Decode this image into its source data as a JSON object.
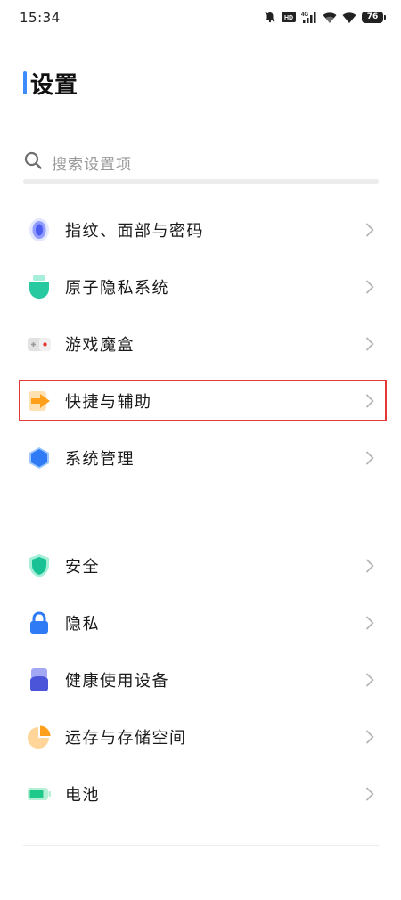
{
  "status_bar": {
    "time": "15:34",
    "battery": "76",
    "icons": [
      "mute-icon",
      "hd-icon",
      "signal-4g-icon",
      "wifi-icon",
      "wifi-icon",
      "battery-icon"
    ]
  },
  "header": {
    "title": "设置"
  },
  "search": {
    "placeholder": "搜索设置项"
  },
  "groups": [
    {
      "items": [
        {
          "label": "指纹、面部与密码",
          "icon": "fingerprint-icon"
        },
        {
          "label": "原子隐私系统",
          "icon": "privacy-system-icon"
        },
        {
          "label": "游戏魔盒",
          "icon": "game-box-icon"
        },
        {
          "label": "快捷与辅助",
          "icon": "shortcut-arrow-icon",
          "highlighted": true
        },
        {
          "label": "系统管理",
          "icon": "hexagon-system-icon"
        }
      ]
    },
    {
      "items": [
        {
          "label": "安全",
          "icon": "shield-icon"
        },
        {
          "label": "隐私",
          "icon": "lock-icon"
        },
        {
          "label": "健康使用设备",
          "icon": "health-usage-icon"
        },
        {
          "label": "运存与存储空间",
          "icon": "storage-pie-icon"
        },
        {
          "label": "电池",
          "icon": "battery-icon"
        }
      ]
    }
  ],
  "colors": {
    "accent": "#3d8bfd",
    "highlight_border": "#e53935",
    "chevron": "#b5b5b5",
    "placeholder": "#9a9a9a"
  }
}
